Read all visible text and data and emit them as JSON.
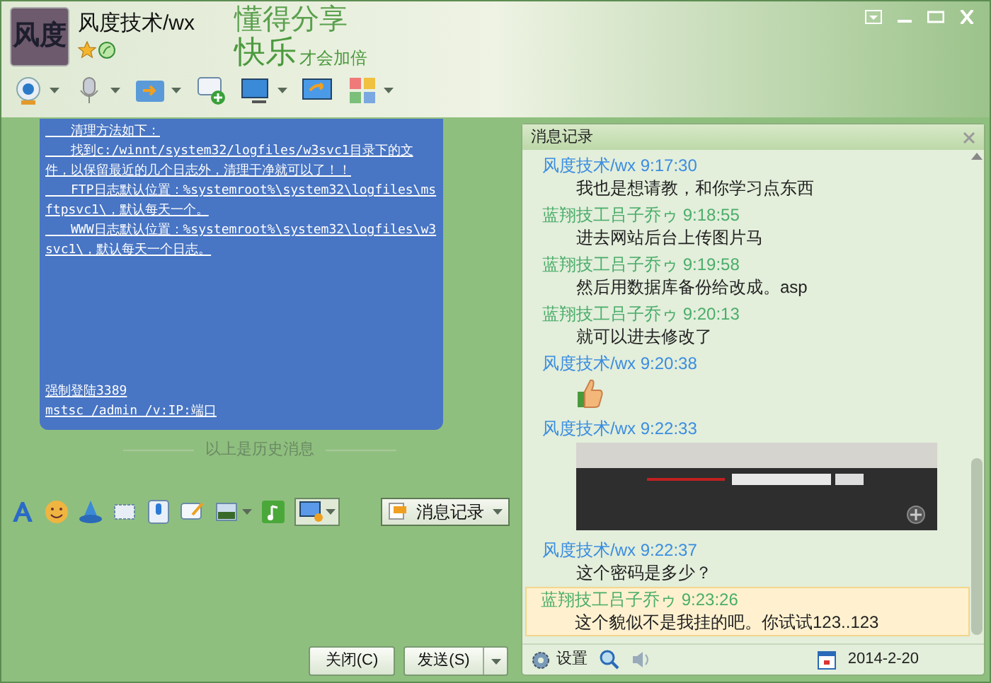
{
  "contact": {
    "name": "风度技术/wx",
    "avatar_text": "风度"
  },
  "banner": {
    "line_1": "懂得分享",
    "line_2": "快乐",
    "line_2_small": "才会加倍"
  },
  "chat_bubble": {
    "paragraphs": [
      "　　清理方法如下：",
      "　　找到c:/winnt/system32/logfiles/w3svc1目录下的文件，以保留最近的几个日志外，清理干净就可以了！！",
      "　　FTP日志默认位置：%systemroot%\\system32\\logfiles\\msftpsvc1\\，默认每天一个。",
      "　　WWW日志默认位置：%systemroot%\\system32\\logfiles\\w3svc1\\，默认每天一个日志。"
    ],
    "footer_lines": [
      "强制登陆3389",
      "mstsc /admin /v:IP:端口"
    ]
  },
  "history_divider": "以上是历史消息",
  "history_button": "消息记录",
  "buttons": {
    "close": "关闭(C)",
    "send": "发送(S)"
  },
  "history_panel": {
    "title": "消息记录",
    "messages": [
      {
        "sender": "风度技术/wx",
        "time": "9:17:30",
        "color": "#3a8de0",
        "kind": "text",
        "text": "我也是想请教，和你学习点东西",
        "selected": false
      },
      {
        "sender": "蓝翔技工吕子乔ゥ",
        "time": "9:18:55",
        "color": "#4aad6a",
        "kind": "text",
        "text": "进去网站后台上传图片马",
        "selected": false
      },
      {
        "sender": "蓝翔技工吕子乔ゥ",
        "time": "9:19:58",
        "color": "#4aad6a",
        "kind": "text",
        "text": "然后用数据库备份给改成。asp",
        "selected": false
      },
      {
        "sender": "蓝翔技工吕子乔ゥ",
        "time": "9:20:13",
        "color": "#4aad6a",
        "kind": "text",
        "text": "就可以进去修改了",
        "selected": false
      },
      {
        "sender": "风度技术/wx",
        "time": "9:20:38",
        "color": "#3a8de0",
        "kind": "emoji",
        "selected": false
      },
      {
        "sender": "风度技术/wx",
        "time": "9:22:33",
        "color": "#3a8de0",
        "kind": "image",
        "selected": false
      },
      {
        "sender": "风度技术/wx",
        "time": "9:22:37",
        "color": "#3a8de0",
        "kind": "text",
        "text": "这个密码是多少？",
        "selected": false
      },
      {
        "sender": "蓝翔技工吕子乔ゥ",
        "time": "9:23:26",
        "color": "#4aad6a",
        "kind": "text",
        "text": "这个貌似不是我挂的吧。你试试123..123",
        "selected": true
      }
    ],
    "settings_label": "设置",
    "date": "2014-2-20"
  }
}
